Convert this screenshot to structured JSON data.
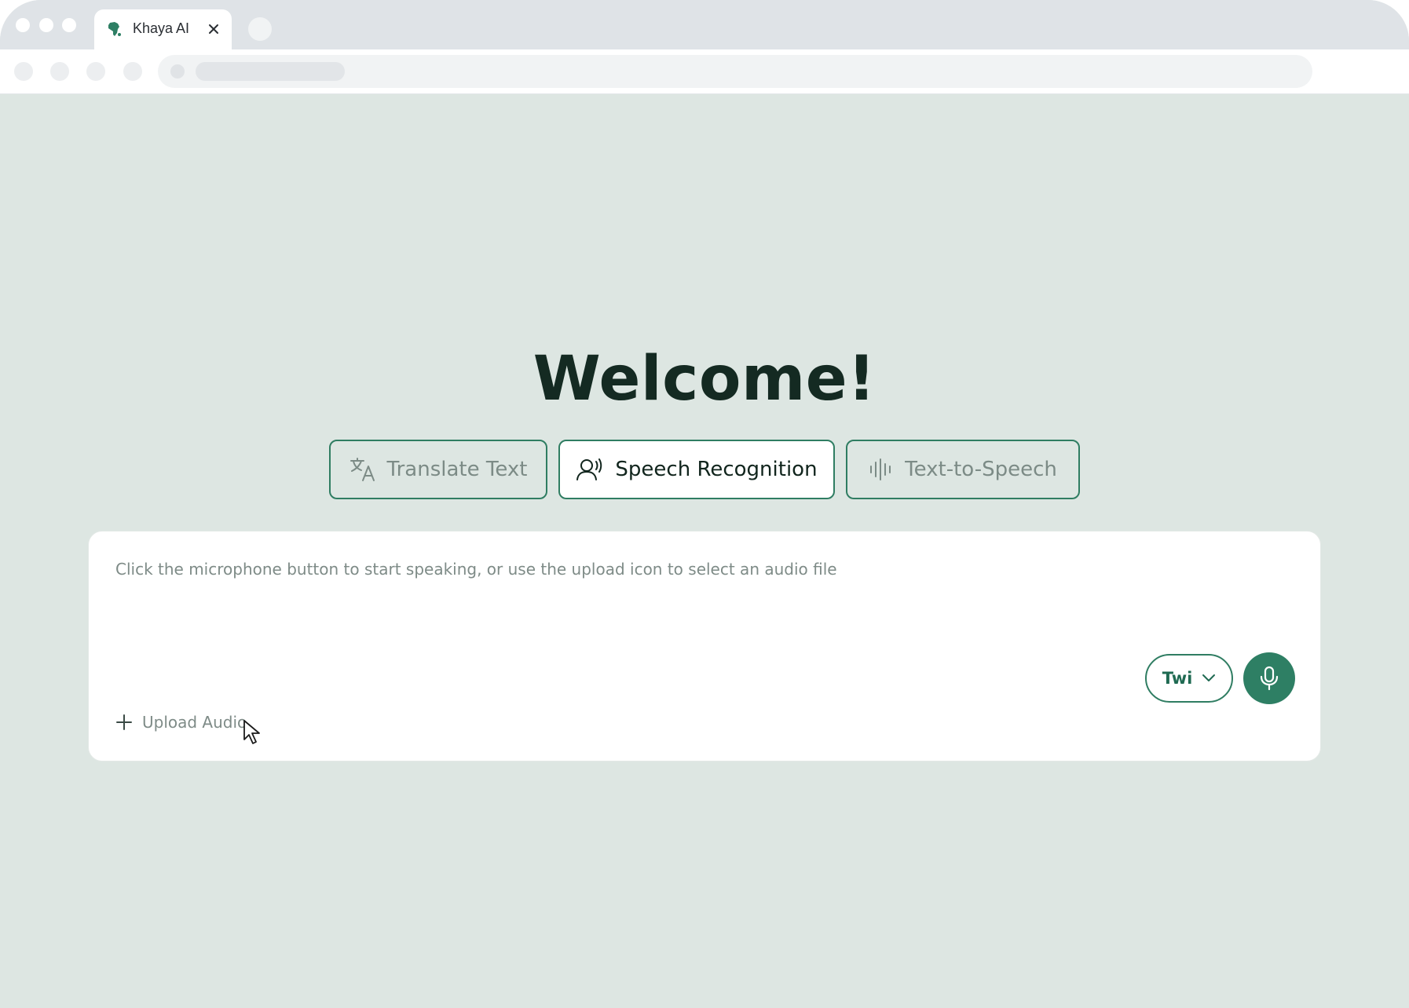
{
  "browser": {
    "tab_title": "Khaya AI",
    "tab_icon": "africa-globe-icon",
    "close_icon": "close-icon"
  },
  "page": {
    "heading": "Welcome!",
    "modes": [
      {
        "label": "Translate Text",
        "icon": "translate-icon",
        "active": false
      },
      {
        "label": "Speech Recognition",
        "icon": "voice-recognition-icon",
        "active": true
      },
      {
        "label": "Text-to-Speech",
        "icon": "sound-wave-icon",
        "active": false
      }
    ],
    "panel": {
      "placeholder": "Click the microphone button to start speaking, or use the upload icon to select an audio file",
      "upload_label": "Upload Audio",
      "language": "Twi"
    }
  },
  "colors": {
    "accent": "#2e7f64",
    "background": "#dde6e2",
    "heading": "#142a22"
  }
}
